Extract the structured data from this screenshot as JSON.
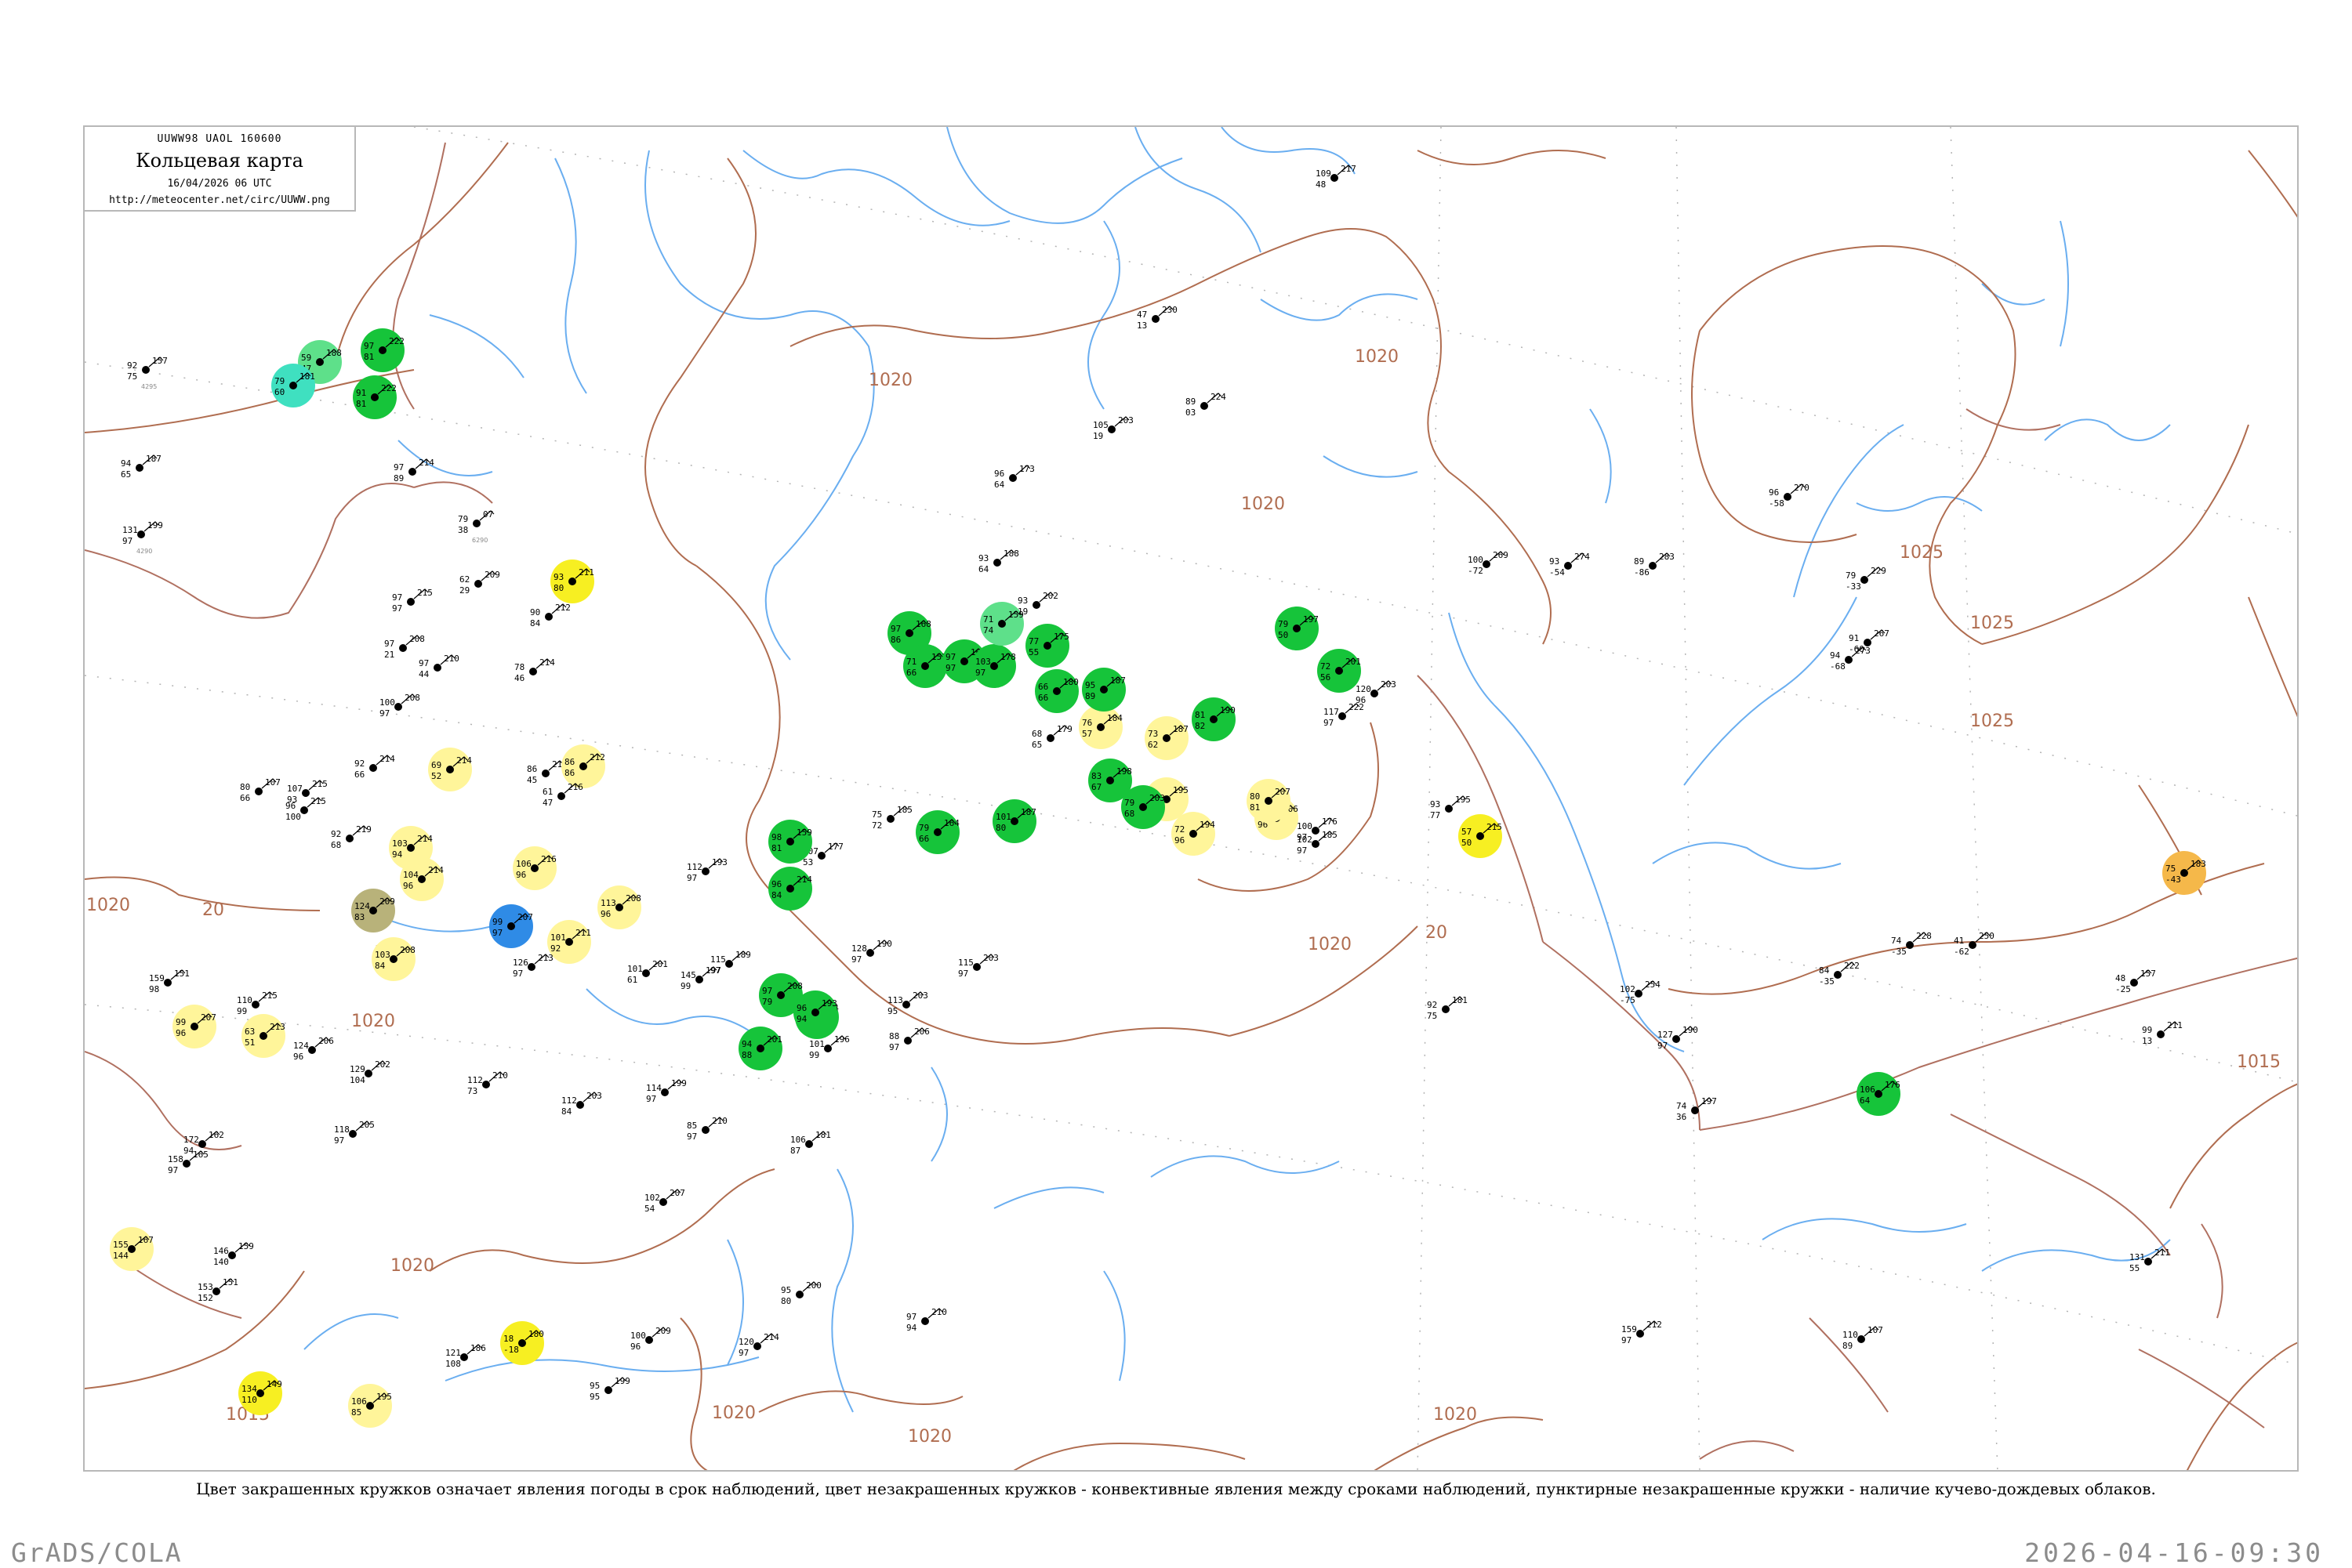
{
  "header": {
    "code": "UUWW98 UAOL 160600",
    "title": "Кольцевая карта",
    "date": "16/04/2026 06 UTC",
    "url": "http://meteocenter.net/circ/UUWW.png"
  },
  "caption": "Цвет закрашенных кружков означает явления погоды в срок наблюдений, цвет незакрашенных кружков - конвективные явления между сроками наблюдений, пунктирные незакрашенные кружки - наличие кучево-дождевых облаков.",
  "footer": {
    "left": "GrADS/COLA",
    "right": "2026-04-16-09:30"
  },
  "colors": {
    "isobar": "#b06d50",
    "water": "#6aaef0",
    "rain": "#16c43a",
    "light_rain": "#5ee08a",
    "fog_haze": "#fff59a",
    "dust": "#f7ef22",
    "snow": "#2f8be6",
    "shower_snow": "#3fe0c0",
    "smoke": "#b8b27a",
    "orange": "#f5b84a",
    "grid": "#b4b4b4"
  },
  "isobar_labels": [
    {
      "value": "1020"
    },
    {
      "value": "1020"
    },
    {
      "value": "1020"
    },
    {
      "value": "1020"
    },
    {
      "value": "1020"
    },
    {
      "value": "1020"
    },
    {
      "value": "1020"
    },
    {
      "value": "1020"
    },
    {
      "value": "1020"
    },
    {
      "value": "1020"
    },
    {
      "value": "1025"
    },
    {
      "value": "1025"
    },
    {
      "value": "1025"
    },
    {
      "value": "1015"
    },
    {
      "value": "1015"
    },
    {
      "value": "20"
    },
    {
      "value": "20"
    },
    {
      "value": "20"
    }
  ],
  "stations": [
    {
      "id": "s1",
      "fill": "rain",
      "t": "97",
      "p": "222",
      "d": "81",
      "name": ""
    },
    {
      "id": "s2",
      "fill": "light_rain",
      "t": "59",
      "p": "188",
      "d": "47",
      "name": ""
    },
    {
      "id": "s3",
      "fill": "shower_snow",
      "t": "79",
      "p": "181",
      "d": "60",
      "name": ""
    },
    {
      "id": "s4",
      "fill": "rain",
      "t": "91",
      "p": "222",
      "d": "81",
      "name": ""
    },
    {
      "id": "s5",
      "fill": "none",
      "t": "92",
      "p": "157",
      "d": "75",
      "name": "4295"
    },
    {
      "id": "s6",
      "fill": "none",
      "t": "94",
      "p": "187",
      "d": "65",
      "name": ""
    },
    {
      "id": "s7",
      "fill": "none",
      "t": "131",
      "p": "199",
      "d": "97",
      "name": "4290"
    },
    {
      "id": "s8",
      "fill": "none",
      "t": "97",
      "p": "214",
      "d": "89",
      "name": ""
    },
    {
      "id": "s9",
      "fill": "none",
      "t": "79",
      "p": "07",
      "d": "38",
      "name": "6290"
    },
    {
      "id": "s10",
      "fill": "dust",
      "t": "93",
      "p": "211",
      "d": "80",
      "name": ""
    },
    {
      "id": "s11",
      "fill": "none",
      "t": "62",
      "p": "209",
      "d": "29",
      "name": ""
    },
    {
      "id": "s12",
      "fill": "none",
      "t": "97",
      "p": "215",
      "d": "97",
      "name": ""
    },
    {
      "id": "s13",
      "fill": "none",
      "t": "90",
      "p": "212",
      "d": "84",
      "name": ""
    },
    {
      "id": "s14",
      "fill": "none",
      "t": "97",
      "p": "208",
      "d": "21",
      "name": ""
    },
    {
      "id": "s15",
      "fill": "none",
      "t": "78",
      "p": "214",
      "d": "46",
      "name": ""
    },
    {
      "id": "s16",
      "fill": "none",
      "t": "100",
      "p": "208",
      "d": "97",
      "name": ""
    },
    {
      "id": "s17",
      "fill": "none",
      "t": "97",
      "p": "210",
      "d": "44",
      "name": ""
    },
    {
      "id": "s18",
      "fill": "fog_haze",
      "t": "69",
      "p": "214",
      "d": "52",
      "name": ""
    },
    {
      "id": "s19",
      "fill": "none",
      "t": "86",
      "p": "215",
      "d": "45",
      "name": ""
    },
    {
      "id": "s20",
      "fill": "fog_haze",
      "t": "86",
      "p": "212",
      "d": "86",
      "name": ""
    },
    {
      "id": "s21",
      "fill": "none",
      "t": "61",
      "p": "216",
      "d": "47",
      "name": ""
    },
    {
      "id": "s22",
      "fill": "none",
      "t": "92",
      "p": "214",
      "d": "66",
      "name": ""
    },
    {
      "id": "s23",
      "fill": "none",
      "t": "80",
      "p": "107",
      "d": "66",
      "name": ""
    },
    {
      "id": "s24",
      "fill": "none",
      "t": "107",
      "p": "215",
      "d": "93",
      "name": ""
    },
    {
      "id": "s25",
      "fill": "none",
      "t": "96",
      "p": "215",
      "d": "100",
      "name": ""
    },
    {
      "id": "s26",
      "fill": "none",
      "t": "92",
      "p": "219",
      "d": "68",
      "name": ""
    },
    {
      "id": "s27",
      "fill": "fog_haze",
      "t": "103",
      "p": "214",
      "d": "94",
      "name": ""
    },
    {
      "id": "s28",
      "fill": "fog_haze",
      "t": "106",
      "p": "216",
      "d": "96",
      "name": ""
    },
    {
      "id": "s29",
      "fill": "fog_haze",
      "t": "104",
      "p": "214",
      "d": "96",
      "name": ""
    },
    {
      "id": "s30",
      "fill": "smoke",
      "t": "124",
      "p": "209",
      "d": "83",
      "name": ""
    },
    {
      "id": "s31",
      "fill": "snow",
      "t": "99",
      "p": "207",
      "d": "97",
      "name": ""
    },
    {
      "id": "s32",
      "fill": "fog_haze",
      "t": "113",
      "p": "208",
      "d": "96",
      "name": ""
    },
    {
      "id": "s33",
      "fill": "fog_haze",
      "t": "103",
      "p": "208",
      "d": "84",
      "name": ""
    },
    {
      "id": "s34",
      "fill": "fog_haze",
      "t": "101",
      "p": "211",
      "d": "92",
      "name": ""
    },
    {
      "id": "s35",
      "fill": "none",
      "t": "126",
      "p": "213",
      "d": "97",
      "name": ""
    },
    {
      "id": "s36",
      "fill": "none",
      "t": "159",
      "p": "151",
      "d": "98",
      "name": ""
    },
    {
      "id": "s37",
      "fill": "fog_haze",
      "t": "99",
      "p": "207",
      "d": "96",
      "name": ""
    },
    {
      "id": "s38",
      "fill": "fog_haze",
      "t": "63",
      "p": "213",
      "d": "51",
      "name": ""
    },
    {
      "id": "s39",
      "fill": "none",
      "t": "110",
      "p": "215",
      "d": "99",
      "name": ""
    },
    {
      "id": "s40",
      "fill": "none",
      "t": "124",
      "p": "206",
      "d": "96",
      "name": ""
    },
    {
      "id": "s41",
      "fill": "none",
      "t": "118",
      "p": "205",
      "d": "97",
      "name": ""
    },
    {
      "id": "s42",
      "fill": "none",
      "t": "129",
      "p": "202",
      "d": "104",
      "name": ""
    },
    {
      "id": "s43",
      "fill": "none",
      "t": "112",
      "p": "210",
      "d": "73",
      "name": ""
    },
    {
      "id": "s44",
      "fill": "none",
      "t": "172",
      "p": "162",
      "d": "94",
      "name": ""
    },
    {
      "id": "s45",
      "fill": "none",
      "t": "158",
      "p": "165",
      "d": "97",
      "name": ""
    },
    {
      "id": "s46",
      "fill": "fog_haze",
      "t": "155",
      "p": "167",
      "d": "144",
      "name": ""
    },
    {
      "id": "s47",
      "fill": "none",
      "t": "146",
      "p": "159",
      "d": "140",
      "name": ""
    },
    {
      "id": "s48",
      "fill": "none",
      "t": "153",
      "p": "151",
      "d": "152",
      "name": ""
    },
    {
      "id": "s49",
      "fill": "dust",
      "t": "134",
      "p": "149",
      "d": "110",
      "name": ""
    },
    {
      "id": "s50",
      "fill": "fog_haze",
      "t": "106",
      "p": "195",
      "d": "85",
      "name": ""
    },
    {
      "id": "s51",
      "fill": "dust",
      "t": "18",
      "p": "180",
      "d": "-18",
      "name": ""
    },
    {
      "id": "s52",
      "fill": "none",
      "t": "121",
      "p": "186",
      "d": "108",
      "name": ""
    },
    {
      "id": "s53",
      "fill": "none",
      "t": "95",
      "p": "199",
      "d": "95",
      "name": ""
    },
    {
      "id": "s54",
      "fill": "none",
      "t": "100",
      "p": "209",
      "d": "96",
      "name": ""
    },
    {
      "id": "s55",
      "fill": "none",
      "t": "120",
      "p": "214",
      "d": "97",
      "name": ""
    },
    {
      "id": "s56",
      "fill": "none",
      "t": "97",
      "p": "210",
      "d": "94",
      "name": ""
    },
    {
      "id": "s57",
      "fill": "none",
      "t": "102",
      "p": "207",
      "d": "54",
      "name": ""
    },
    {
      "id": "s58",
      "fill": "none",
      "t": "95",
      "p": "200",
      "d": "80",
      "name": ""
    },
    {
      "id": "s59",
      "fill": "none",
      "t": "114",
      "p": "199",
      "d": "97",
      "name": ""
    },
    {
      "id": "s60",
      "fill": "none",
      "t": "112",
      "p": "203",
      "d": "84",
      "name": ""
    },
    {
      "id": "s61",
      "fill": "none",
      "t": "145",
      "p": "197",
      "d": "99",
      "name": ""
    },
    {
      "id": "s62",
      "fill": "none",
      "t": "101",
      "p": "201",
      "d": "61",
      "name": ""
    },
    {
      "id": "s63",
      "fill": "none",
      "t": "112",
      "p": "193",
      "d": "97",
      "name": ""
    },
    {
      "id": "s64",
      "fill": "rain",
      "t": "96",
      "p": "214",
      "d": "84",
      "name": ""
    },
    {
      "id": "s65",
      "fill": "rain",
      "t": "96",
      "p": "194",
      "d": "86",
      "name": ""
    },
    {
      "id": "s66",
      "fill": "rain",
      "t": "97",
      "p": "208",
      "d": "79",
      "name": ""
    },
    {
      "id": "s67",
      "fill": "rain",
      "t": "96",
      "p": "193",
      "d": "94",
      "name": ""
    },
    {
      "id": "s68",
      "fill": "rain",
      "t": "94",
      "p": "201",
      "d": "88",
      "name": ""
    },
    {
      "id": "s69",
      "fill": "none",
      "t": "101",
      "p": "196",
      "d": "99",
      "name": ""
    },
    {
      "id": "s70",
      "fill": "none",
      "t": "115",
      "p": "189",
      "d": "97",
      "name": ""
    },
    {
      "id": "s71",
      "fill": "none",
      "t": "128",
      "p": "190",
      "d": "97",
      "name": ""
    },
    {
      "id": "s72",
      "fill": "none",
      "t": "115",
      "p": "203",
      "d": "97",
      "name": ""
    },
    {
      "id": "s73",
      "fill": "none",
      "t": "113",
      "p": "203",
      "d": "95",
      "name": ""
    },
    {
      "id": "s74",
      "fill": "none",
      "t": "88",
      "p": "206",
      "d": "97",
      "name": ""
    },
    {
      "id": "s75",
      "fill": "none",
      "t": "85",
      "p": "210",
      "d": "97",
      "name": ""
    },
    {
      "id": "s76",
      "fill": "none",
      "t": "106",
      "p": "181",
      "d": "87",
      "name": ""
    },
    {
      "id": "s77",
      "fill": "none",
      "t": "107",
      "p": "177",
      "d": "53",
      "name": ""
    },
    {
      "id": "s78",
      "fill": "rain",
      "t": "98",
      "p": "159",
      "d": "81",
      "name": ""
    },
    {
      "id": "s79",
      "fill": "rain",
      "t": "97",
      "p": "168",
      "d": "86",
      "name": ""
    },
    {
      "id": "s80",
      "fill": "rain",
      "t": "71",
      "p": "157",
      "d": "66",
      "name": ""
    },
    {
      "id": "s81",
      "fill": "rain",
      "t": "97",
      "p": "160",
      "d": "97",
      "name": ""
    },
    {
      "id": "s82",
      "fill": "rain",
      "t": "103",
      "p": "178",
      "d": "97",
      "name": ""
    },
    {
      "id": "s83",
      "fill": "rain",
      "t": "77",
      "p": "175",
      "d": "55",
      "name": ""
    },
    {
      "id": "s84",
      "fill": "rain",
      "t": "66",
      "p": "180",
      "d": "66",
      "name": ""
    },
    {
      "id": "s85",
      "fill": "light_rain",
      "t": "71",
      "p": "159",
      "d": "74",
      "name": ""
    },
    {
      "id": "s86",
      "fill": "none",
      "t": "68",
      "p": "179",
      "d": "65",
      "name": ""
    },
    {
      "id": "s87",
      "fill": "fog_haze",
      "t": "76",
      "p": "184",
      "d": "57",
      "name": ""
    },
    {
      "id": "s88",
      "fill": "fog_haze",
      "t": "73",
      "p": "187",
      "d": "62",
      "name": ""
    },
    {
      "id": "s89",
      "fill": "fog_haze",
      "t": "72",
      "p": "195",
      "d": "68",
      "name": ""
    },
    {
      "id": "s90",
      "fill": "fog_haze",
      "t": "72",
      "p": "194",
      "d": "96",
      "name": ""
    },
    {
      "id": "s91",
      "fill": "fog_haze",
      "t": "77",
      "p": "206",
      "d": "96",
      "name": ""
    },
    {
      "id": "s92",
      "fill": "fog_haze",
      "t": "80",
      "p": "207",
      "d": "81",
      "name": ""
    },
    {
      "id": "s93",
      "fill": "none",
      "t": "100",
      "p": "176",
      "d": "97",
      "name": ""
    },
    {
      "id": "s94",
      "fill": "none",
      "t": "102",
      "p": "185",
      "d": "97",
      "name": ""
    },
    {
      "id": "s95",
      "fill": "none",
      "t": "75",
      "p": "185",
      "d": "72",
      "name": ""
    },
    {
      "id": "s96",
      "fill": "rain",
      "t": "79",
      "p": "164",
      "d": "66",
      "name": ""
    },
    {
      "id": "s97",
      "fill": "rain",
      "t": "101",
      "p": "187",
      "d": "80",
      "name": ""
    },
    {
      "id": "s98",
      "fill": "rain",
      "t": "95",
      "p": "187",
      "d": "89",
      "name": ""
    },
    {
      "id": "s99",
      "fill": "rain",
      "t": "81",
      "p": "190",
      "d": "82",
      "name": ""
    },
    {
      "id": "s100",
      "fill": "rain",
      "t": "83",
      "p": "198",
      "d": "67",
      "name": ""
    },
    {
      "id": "s101",
      "fill": "rain",
      "t": "79",
      "p": "203",
      "d": "68",
      "name": ""
    },
    {
      "id": "s102",
      "fill": "rain",
      "t": "79",
      "p": "197",
      "d": "50",
      "name": ""
    },
    {
      "id": "s103",
      "fill": "rain",
      "t": "72",
      "p": "201",
      "d": "56",
      "name": ""
    },
    {
      "id": "s104",
      "fill": "none",
      "t": "117",
      "p": "222",
      "d": "97",
      "name": ""
    },
    {
      "id": "s105",
      "fill": "none",
      "t": "120",
      "p": "203",
      "d": "96",
      "name": ""
    },
    {
      "id": "s106",
      "fill": "none",
      "t": "93",
      "p": "195",
      "d": "77",
      "name": ""
    },
    {
      "id": "s107",
      "fill": "dust",
      "t": "57",
      "p": "215",
      "d": "50",
      "name": ""
    },
    {
      "id": "s108",
      "fill": "none",
      "t": "92",
      "p": "181",
      "d": "75",
      "name": ""
    },
    {
      "id": "s109",
      "fill": "none",
      "t": "96",
      "p": "173",
      "d": "64",
      "name": ""
    },
    {
      "id": "s110",
      "fill": "none",
      "t": "93",
      "p": "188",
      "d": "64",
      "name": ""
    },
    {
      "id": "s111",
      "fill": "none",
      "t": "93",
      "p": "202",
      "d": "19",
      "name": ""
    },
    {
      "id": "s112",
      "fill": "none",
      "t": "105",
      "p": "203",
      "d": "19",
      "name": ""
    },
    {
      "id": "s113",
      "fill": "none",
      "t": "89",
      "p": "224",
      "d": "03",
      "name": ""
    },
    {
      "id": "s114",
      "fill": "none",
      "t": "47",
      "p": "230",
      "d": "13",
      "name": ""
    },
    {
      "id": "s115",
      "fill": "none",
      "t": "109",
      "p": "217",
      "d": "48",
      "name": ""
    },
    {
      "id": "s116",
      "fill": "none",
      "t": "102",
      "p": "254",
      "d": "-75",
      "name": ""
    },
    {
      "id": "s117",
      "fill": "none",
      "t": "100",
      "p": "269",
      "d": "-72",
      "name": ""
    },
    {
      "id": "s118",
      "fill": "none",
      "t": "93",
      "p": "274",
      "d": "-54",
      "name": ""
    },
    {
      "id": "s119",
      "fill": "none",
      "t": "89",
      "p": "283",
      "d": "-86",
      "name": ""
    },
    {
      "id": "s120",
      "fill": "none",
      "t": "96",
      "p": "270",
      "d": "-58",
      "name": ""
    },
    {
      "id": "s121",
      "fill": "none",
      "t": "94",
      "p": "273",
      "d": "-68",
      "name": ""
    },
    {
      "id": "s122",
      "fill": "none",
      "t": "91",
      "p": "267",
      "d": "-60",
      "name": ""
    },
    {
      "id": "s123",
      "fill": "none",
      "t": "79",
      "p": "229",
      "d": "-33",
      "name": ""
    },
    {
      "id": "s124",
      "fill": "none",
      "t": "84",
      "p": "222",
      "d": "-35",
      "name": ""
    },
    {
      "id": "s125",
      "fill": "none",
      "t": "74",
      "p": "228",
      "d": "-35",
      "name": ""
    },
    {
      "id": "s126",
      "fill": "none",
      "t": "41",
      "p": "250",
      "d": "-62",
      "name": ""
    },
    {
      "id": "s127",
      "fill": "orange",
      "t": "75",
      "p": "183",
      "d": "-43",
      "name": ""
    },
    {
      "id": "s128",
      "fill": "none",
      "t": "48",
      "p": "157",
      "d": "-25",
      "name": ""
    },
    {
      "id": "s129",
      "fill": "none",
      "t": "99",
      "p": "211",
      "d": "13",
      "name": ""
    },
    {
      "id": "s130",
      "fill": "none",
      "t": "127",
      "p": "190",
      "d": "97",
      "name": ""
    },
    {
      "id": "s131",
      "fill": "none",
      "t": "74",
      "p": "197",
      "d": "36",
      "name": ""
    },
    {
      "id": "s132",
      "fill": "rain",
      "t": "106",
      "p": "176",
      "d": "64",
      "name": ""
    },
    {
      "id": "s133",
      "fill": "none",
      "t": "110",
      "p": "107",
      "d": "89",
      "name": ""
    },
    {
      "id": "s134",
      "fill": "none",
      "t": "131",
      "p": "211",
      "d": "55",
      "name": ""
    },
    {
      "id": "s135",
      "fill": "none",
      "t": "159",
      "p": "212",
      "d": "97",
      "name": ""
    }
  ]
}
